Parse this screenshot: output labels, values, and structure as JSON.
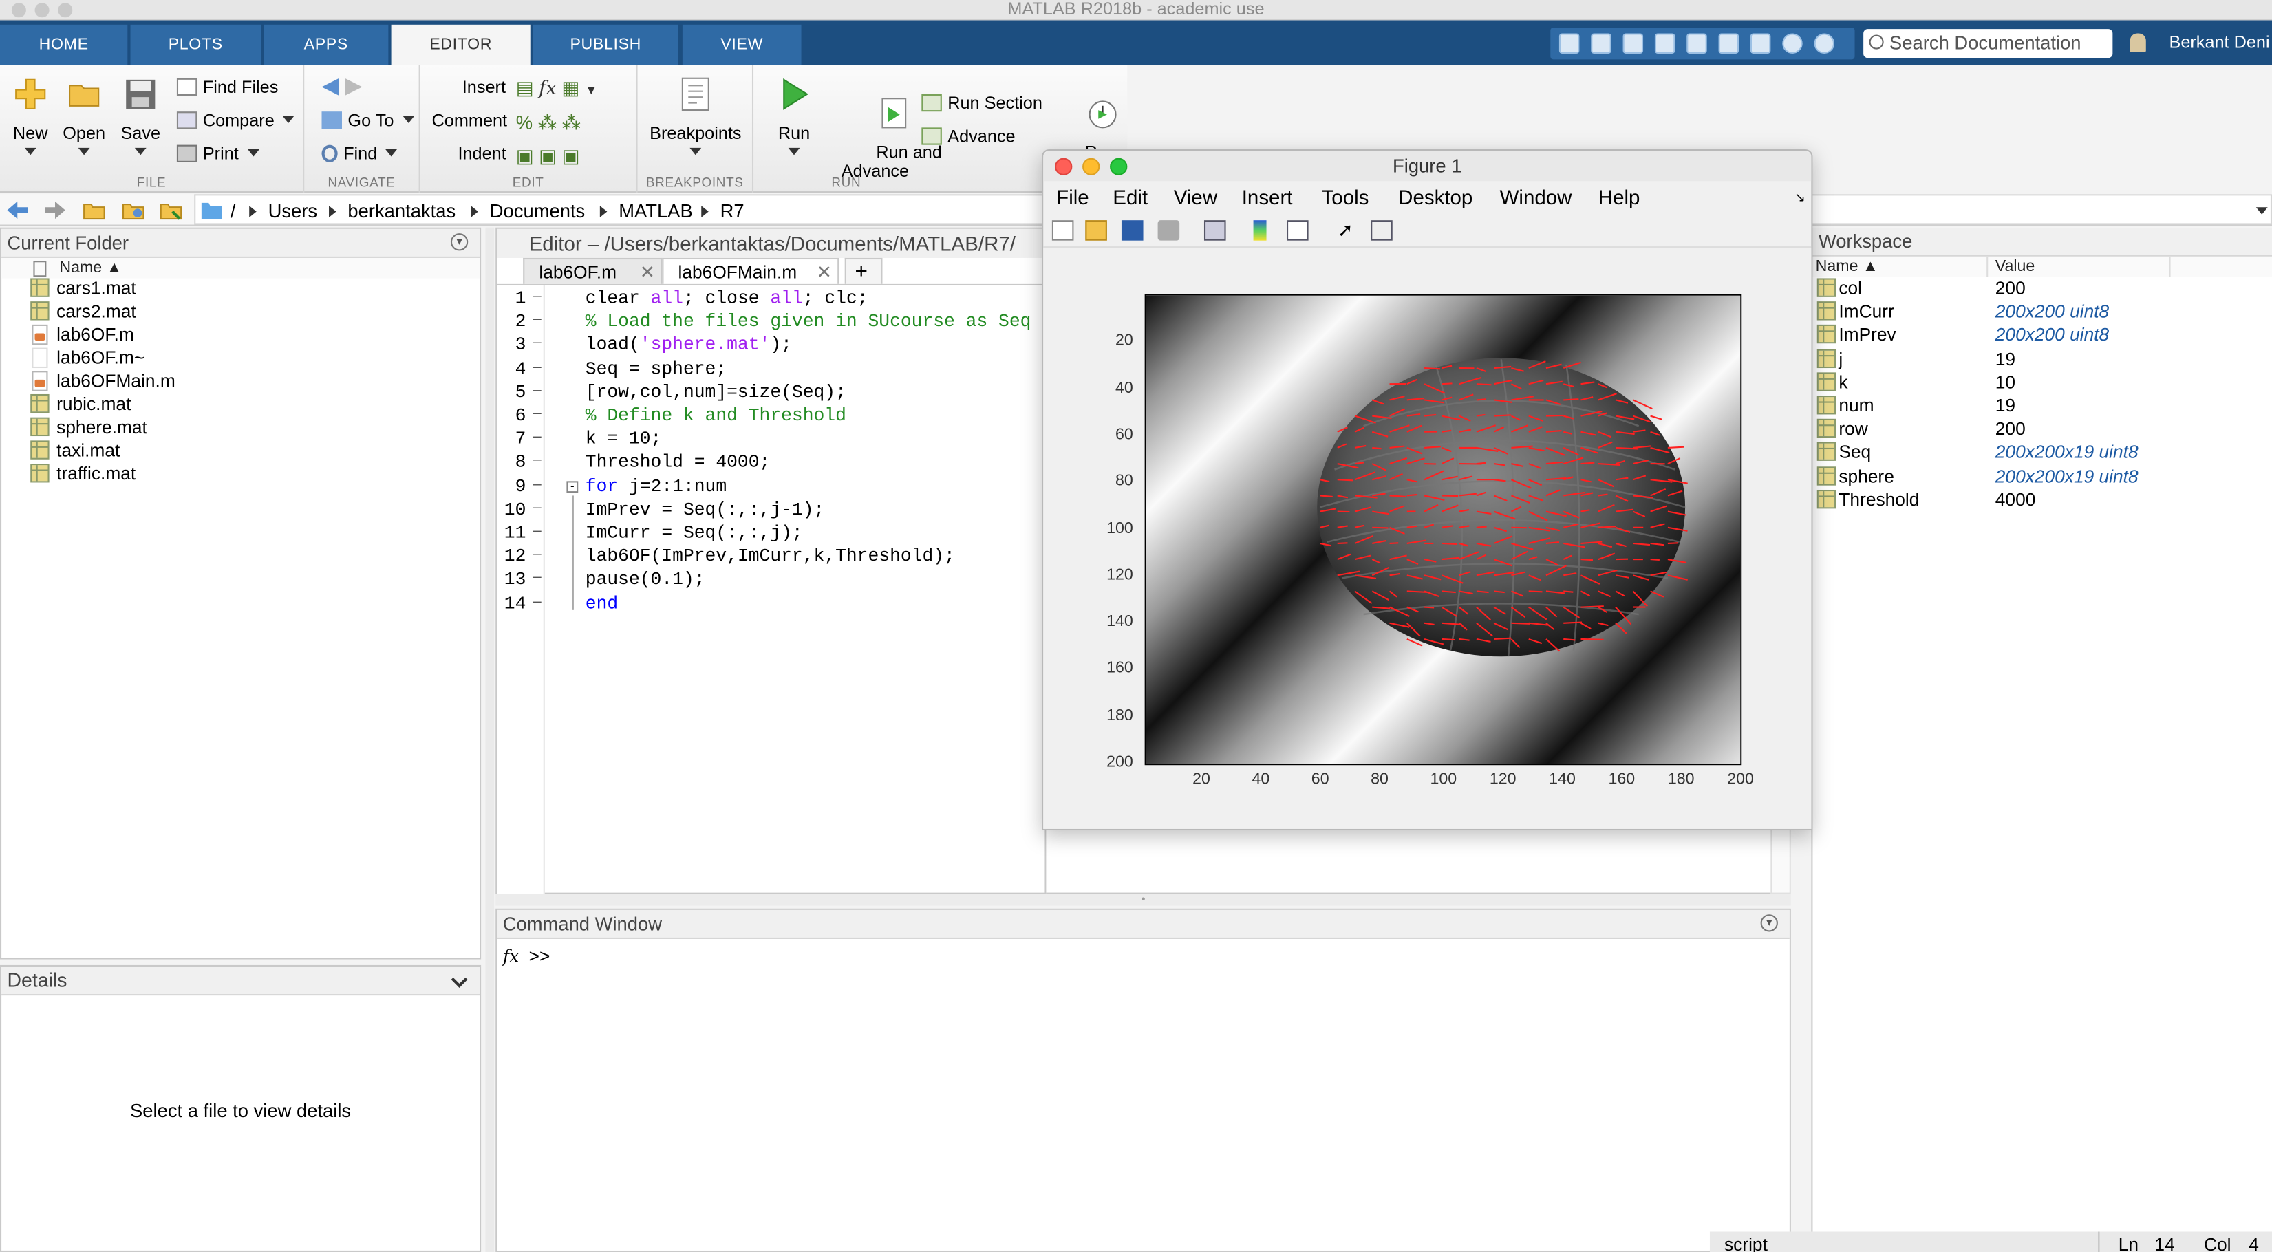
{
  "window_title": "MATLAB R2018b - academic use",
  "tabs": [
    {
      "label": "HOME"
    },
    {
      "label": "PLOTS"
    },
    {
      "label": "APPS"
    },
    {
      "label": "EDITOR"
    },
    {
      "label": "PUBLISH"
    },
    {
      "label": "VIEW"
    }
  ],
  "search_placeholder": "Search Documentation",
  "user_name": "Berkant Deni",
  "ribbon": {
    "file": {
      "section": "FILE",
      "new": "New",
      "open": "Open",
      "save": "Save",
      "find_files": "Find Files",
      "compare": "Compare",
      "print": "Print"
    },
    "navigate": {
      "section": "NAVIGATE",
      "go_to": "Go To",
      "find": "Find"
    },
    "edit": {
      "section": "EDIT",
      "insert": "Insert",
      "comment": "Comment",
      "indent": "Indent"
    },
    "breakpoints": {
      "section": "BREAKPOINTS",
      "label": "Breakpoints"
    },
    "run": {
      "section": "RUN",
      "run": "Run",
      "run_and_advance": "Run and\nAdvance",
      "run_section": "Run Section",
      "advance": "Advance",
      "run_and_time": "Run and\nTime"
    }
  },
  "address": {
    "root": "/",
    "parts": [
      "Users",
      "berkantaktas",
      "Documents",
      "MATLAB",
      "R7"
    ]
  },
  "current_folder": {
    "title": "Current Folder",
    "column": "Name ▲",
    "files": [
      {
        "name": "cars1.mat",
        "type": "mat"
      },
      {
        "name": "cars2.mat",
        "type": "mat"
      },
      {
        "name": "lab6OF.m",
        "type": "m"
      },
      {
        "name": "lab6OF.m~",
        "type": "other"
      },
      {
        "name": "lab6OFMain.m",
        "type": "m"
      },
      {
        "name": "rubic.mat",
        "type": "mat"
      },
      {
        "name": "sphere.mat",
        "type": "mat"
      },
      {
        "name": "taxi.mat",
        "type": "mat"
      },
      {
        "name": "traffic.mat",
        "type": "mat"
      }
    ]
  },
  "details": {
    "title": "Details",
    "message": "Select a file to view details"
  },
  "editor": {
    "title": "Editor – /Users/berkantaktas/Documents/MATLAB/R7/",
    "tabs": [
      {
        "label": "lab6OF.m"
      },
      {
        "label": "lab6OFMain.m"
      }
    ],
    "add_tab": "+",
    "lines": [
      {
        "n": "1",
        "code": "clear all; close all; clc;"
      },
      {
        "n": "2",
        "code": "% Load the files given in SUcourse as Seq"
      },
      {
        "n": "3",
        "code": "load('sphere.mat');"
      },
      {
        "n": "4",
        "code": "Seq = sphere;"
      },
      {
        "n": "5",
        "code": "[row,col,num]=size(Seq);"
      },
      {
        "n": "6",
        "code": "% Define k and Threshold"
      },
      {
        "n": "7",
        "code": "k = 10;"
      },
      {
        "n": "8",
        "code": "Threshold = 4000;"
      },
      {
        "n": "9",
        "code": "for j=2:1:num"
      },
      {
        "n": "10",
        "code": "ImPrev = Seq(:,:,j-1);"
      },
      {
        "n": "11",
        "code": "ImCurr = Seq(:,:,j);"
      },
      {
        "n": "12",
        "code": "lab6OF(ImPrev,ImCurr,k,Threshold);"
      },
      {
        "n": "13",
        "code": "pause(0.1);"
      },
      {
        "n": "14",
        "code": "end"
      }
    ]
  },
  "command_window": {
    "title": "Command Window",
    "fx": "fx",
    "prompt": ">>"
  },
  "figure": {
    "title": "Figure 1",
    "menu": [
      "File",
      "Edit",
      "View",
      "Insert",
      "Tools",
      "Desktop",
      "Window",
      "Help"
    ],
    "y_ticks": [
      "20",
      "40",
      "60",
      "80",
      "100",
      "120",
      "140",
      "160",
      "180",
      "200"
    ],
    "x_ticks": [
      "20",
      "40",
      "60",
      "80",
      "100",
      "120",
      "140",
      "160",
      "180",
      "200"
    ]
  },
  "workspace": {
    "title": "Workspace",
    "col_name": "Name ▲",
    "col_value": "Value",
    "vars": [
      {
        "name": "col",
        "value": "200",
        "italic": false
      },
      {
        "name": "ImCurr",
        "value": "200x200 uint8",
        "italic": true
      },
      {
        "name": "ImPrev",
        "value": "200x200 uint8",
        "italic": true
      },
      {
        "name": "j",
        "value": "19",
        "italic": false
      },
      {
        "name": "k",
        "value": "10",
        "italic": false
      },
      {
        "name": "num",
        "value": "19",
        "italic": false
      },
      {
        "name": "row",
        "value": "200",
        "italic": false
      },
      {
        "name": "Seq",
        "value": "200x200x19 uint8",
        "italic": true
      },
      {
        "name": "sphere",
        "value": "200x200x19 uint8",
        "italic": true
      },
      {
        "name": "Threshold",
        "value": "4000",
        "italic": false
      }
    ]
  },
  "status": {
    "type": "script",
    "ln_label": "Ln",
    "ln": "14",
    "col_label": "Col",
    "col": "4"
  },
  "colors": {
    "tabbar": "#1c4e80",
    "tab": "#2f6aa5",
    "keyword": "#0000ff",
    "string": "#a020f0",
    "comment": "#228b22",
    "variable_value": "#1d5aa3",
    "flow_vectors": "#ff0000"
  }
}
